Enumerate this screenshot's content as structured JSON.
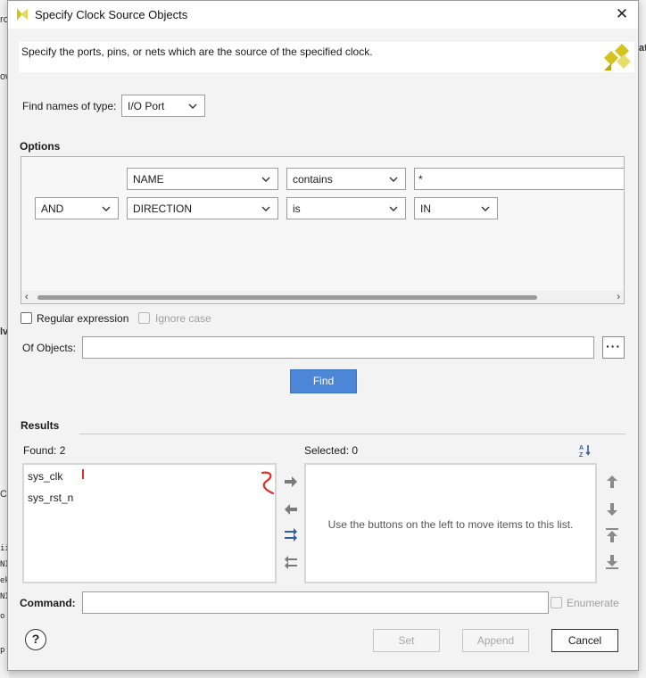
{
  "background": {
    "fragments": [
      "ro",
      "ow",
      "ate",
      "lv",
      "Co",
      "ii",
      "NI",
      "ek",
      "NI",
      "o",
      "p"
    ]
  },
  "dialog": {
    "title": "Specify Clock Source Objects",
    "description": "Specify the ports, pins, or nets which are the source of the specified clock.",
    "find_type": {
      "label": "Find names of type:",
      "value": "I/O Port"
    },
    "options": {
      "heading": "Options",
      "row1": {
        "field": "NAME",
        "operator": "contains",
        "value": "*"
      },
      "row2": {
        "conjunction": "AND",
        "field": "DIRECTION",
        "operator": "is",
        "value": "IN"
      }
    },
    "regular_expression_label": "Regular expression",
    "ignore_case_label": "Ignore case",
    "of_objects_label": "Of Objects:",
    "of_objects_value": "",
    "more_button": "···",
    "find_button": "Find",
    "results": {
      "heading": "Results",
      "found_label": "Found: 2",
      "found_items": [
        "sys_clk",
        "sys_rst_n"
      ],
      "selected_label": "Selected: 0",
      "selected_placeholder": "Use the buttons on the left to move items to this list."
    },
    "command_label": "Command:",
    "command_value": "",
    "enumerate_label": "Enumerate",
    "help_button": "?",
    "set_button": "Set",
    "append_button": "Append",
    "cancel_button": "Cancel"
  },
  "colors": {
    "find_button_bg": "#4d86d6",
    "annotation_red": "#e0302a",
    "arrow_blue": "#2f5fa8",
    "logo_yellow": "#d4c21d"
  }
}
